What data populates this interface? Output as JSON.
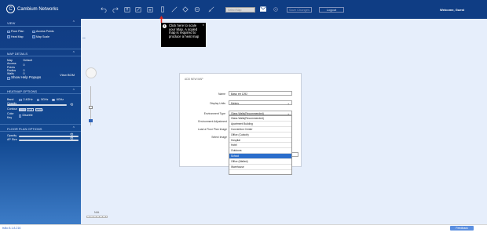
{
  "brand": {
    "name": "Cambium Networks"
  },
  "toolbar": {
    "map_select": "Select Map",
    "save_label": "Save Changes",
    "logout_label": "Logout",
    "welcome": "Welcome, Guest"
  },
  "sidebar": {
    "view": {
      "title": "VIEW",
      "options": [
        "Floor Plan",
        "Access Points",
        "Heat Map",
        "Map Scale"
      ]
    },
    "map_details": {
      "title": "MAP DETAILS",
      "rows": [
        {
          "label": "Map",
          "value": "Default"
        },
        {
          "label": "Access Points",
          "value": "0"
        },
        {
          "label": "Radios",
          "value": "0"
        },
        {
          "label": "Walls",
          "value": "0"
        }
      ],
      "show_help": "Show Help Popups",
      "view_bom": "View BOM"
    },
    "heatmap": {
      "title": "HEATMAP OPTIONS",
      "band_label": "Band",
      "bands": [
        "2.4GHz",
        "5GHz",
        "6GHz"
      ],
      "opacity_label": "Opacity",
      "contour_label": "Contour",
      "contour_options": [
        "None",
        "Full",
        "Outline"
      ],
      "colorkey_label": "Color Key",
      "colorkey_option": "Discrete"
    },
    "floorplan": {
      "title": "FLOOR PLAN OPTIONS",
      "opacity_label": "Opacity",
      "apsize_label": "AP Size"
    }
  },
  "tooltip": {
    "text": "Click here to scale your Map. A scaled map is required to produce a heat map"
  },
  "dialog": {
    "title": "ADD NEW MAP",
    "name_label": "Name",
    "name_value": "Basic etr 1292",
    "units_label": "Display Units",
    "units_value": "Meters",
    "env_label": "Environment Type",
    "env_value": "Glass Walls(Recommended)",
    "adjust_label": "Environment Adjustment",
    "floorplan_label": "Load a Floor Plan Image",
    "select_label": "Select Image"
  },
  "dropdown": {
    "items": [
      "Glass Walls(Recommended)",
      "Apartment Building",
      "Convention Center",
      "Office (Cubicle)",
      "Hospital",
      "Hotel",
      "Outdoors",
      "School",
      "Office (Walled)",
      "Warehouse"
    ],
    "selected_index": 7
  },
  "scale": {
    "label": "N/A"
  },
  "footer": {
    "version": "tsNo 8.1.8.216",
    "feedback": "Feedback"
  },
  "colors": {
    "topbar": "#0f3d84",
    "sidebar": "#134a93",
    "canvas": "#e6eefb",
    "selected": "#2a6dcb"
  }
}
